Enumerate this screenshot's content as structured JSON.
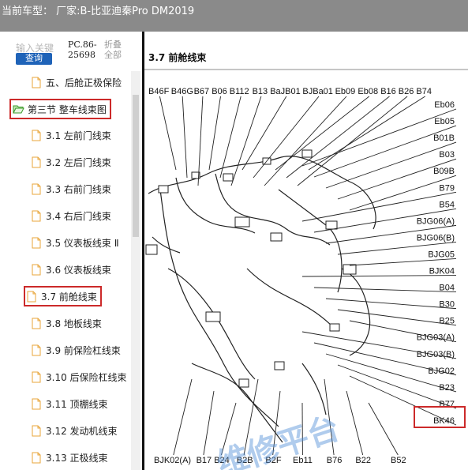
{
  "header": {
    "title": "当前车型：  厂家:B-比亚迪秦Pro DM2019"
  },
  "sidebar": {
    "search_placeholder": "输入关键",
    "search_button": "查询",
    "pc_code_line1": "PC.86-",
    "pc_code_line2": "25698",
    "fold_line1": "折叠",
    "fold_line2": "全部",
    "items": [
      {
        "label": "五、后舱正极保险",
        "icon": "file-icon"
      },
      {
        "label": "第三节 整车线束图",
        "icon": "folder-open-icon"
      },
      {
        "label": "3.1 左前门线束",
        "icon": "file-icon"
      },
      {
        "label": "3.2 左后门线束",
        "icon": "file-icon"
      },
      {
        "label": "3.3 右前门线束",
        "icon": "file-icon"
      },
      {
        "label": "3.4 右后门线束",
        "icon": "file-icon"
      },
      {
        "label": "3.5 仪表板线束 Ⅱ",
        "icon": "file-icon"
      },
      {
        "label": "3.6 仪表板线束",
        "icon": "file-icon"
      },
      {
        "label": "3.7 前舱线束",
        "icon": "file-icon"
      },
      {
        "label": "3.8 地板线束",
        "icon": "file-icon"
      },
      {
        "label": "3.9 前保险杠线束",
        "icon": "file-icon"
      },
      {
        "label": "3.10 后保险杠线束",
        "icon": "file-icon"
      },
      {
        "label": "3.11 顶棚线束",
        "icon": "file-icon"
      },
      {
        "label": "3.12 发动机线束",
        "icon": "file-icon"
      },
      {
        "label": "3.13 正极线束",
        "icon": "file-icon"
      }
    ]
  },
  "document": {
    "section_title": "3.7  前舱线束",
    "top_labels": [
      "B46F",
      "B46G",
      "B67",
      "B06",
      "B112",
      "B13",
      "BaJB01",
      "BJBa01",
      "Eb09",
      "Eb08",
      "B16",
      "B26",
      "B74"
    ],
    "right_labels": [
      "Eb06",
      "Eb05",
      "B01B",
      "B03",
      "B09B",
      "B79",
      "B54",
      "BJG06(A)",
      "BJG06(B)",
      "BJG05",
      "BJK04",
      "B04",
      "B30",
      "B25",
      "BJG03(A)",
      "BJG03(B)",
      "BJG02",
      "B23",
      "B77",
      "BK46"
    ],
    "bottom_labels": [
      "BJK02(A)",
      "B17",
      "B24",
      "B2B",
      "B2F",
      "Eb11",
      "B76",
      "B22",
      "B52"
    ],
    "watermark": "维修平台"
  },
  "colors": {
    "header_bg": "#8a8a8a",
    "accent_blue": "#1f63b8",
    "highlight_red": "#cc2a2a",
    "folder_green": "#3c9a2c",
    "file_orange": "#e8a53a"
  }
}
